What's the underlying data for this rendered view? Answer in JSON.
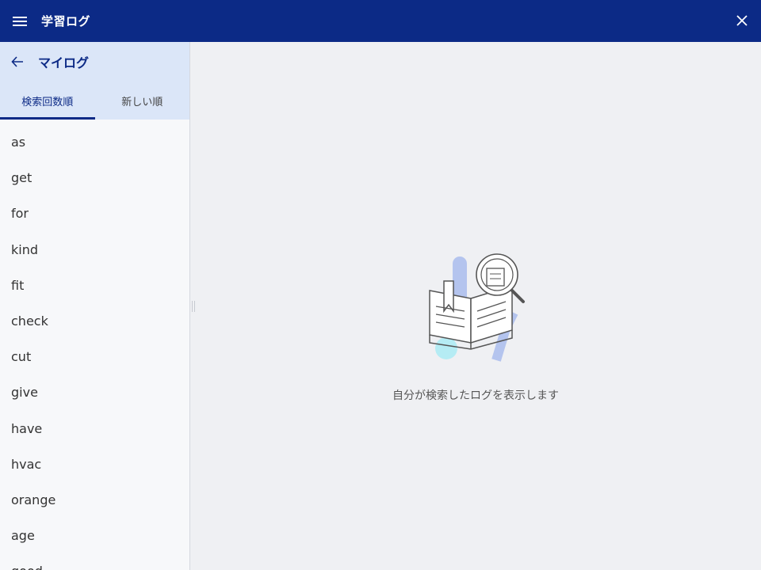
{
  "header": {
    "title": "学習ログ",
    "menu_icon": "hamburger-menu-icon",
    "close_icon": "close-icon"
  },
  "sidebar": {
    "title": "マイログ",
    "back_icon": "arrow-left-icon",
    "tabs": [
      {
        "label": "検索回数順",
        "active": true
      },
      {
        "label": "新しい順",
        "active": false
      }
    ],
    "words": [
      "as",
      "get",
      "for",
      "kind",
      "fit",
      "check",
      "cut",
      "give",
      "have",
      "hvac",
      "orange",
      "age",
      "good"
    ]
  },
  "main": {
    "illustration_icon": "book-search-icon",
    "empty_message": "自分が検索したログを表示します"
  },
  "colors": {
    "header_bg": "#0c2a86",
    "sidebar_head_bg": "#dbe6f8",
    "main_bg": "#eff0f3"
  }
}
